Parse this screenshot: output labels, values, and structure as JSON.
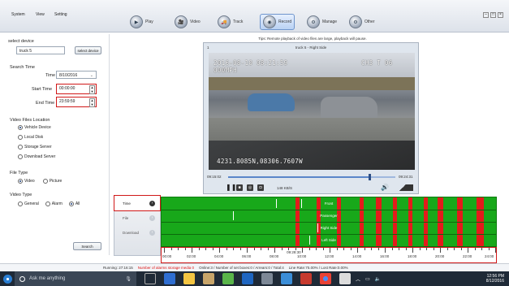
{
  "menu": [
    "System",
    "View",
    "Setting"
  ],
  "nav": [
    {
      "label": "Play",
      "icon": "play-icon",
      "glyph": "▶",
      "active": false
    },
    {
      "label": "Video",
      "icon": "video-icon",
      "glyph": "🎥",
      "active": false
    },
    {
      "label": "Track",
      "icon": "track-icon",
      "glyph": "🚚",
      "active": false
    },
    {
      "label": "Record",
      "icon": "record-icon",
      "glyph": "◉",
      "active": true
    },
    {
      "label": "Manage",
      "icon": "manage-icon",
      "glyph": "⚙",
      "active": false
    },
    {
      "label": "Other",
      "icon": "other-icon",
      "glyph": "⚙",
      "active": false
    }
  ],
  "left": {
    "select_device_heading": "select device",
    "device_value": "truck 5",
    "select_device_button": "select device",
    "search_time_heading": "Search Time",
    "time_label": "Time",
    "date_value": "8/10/2016",
    "start_label": "Start Time",
    "start_value": "00:00:00",
    "end_label": "End Time",
    "end_value": "23:59:59",
    "location_heading": "Video Files Location",
    "locations": [
      {
        "label": "Vehicle Device",
        "on": true
      },
      {
        "label": "Local Disk",
        "on": false
      },
      {
        "label": "Storage Server",
        "on": false
      },
      {
        "label": "Download Server",
        "on": false
      }
    ],
    "file_type_heading": "File Type",
    "file_types": [
      {
        "label": "Video",
        "on": true
      },
      {
        "label": "Picture",
        "on": false
      }
    ],
    "video_type_heading": "Video Type",
    "video_types": [
      {
        "label": "General",
        "on": false
      },
      {
        "label": "Alarm",
        "on": false
      },
      {
        "label": "All",
        "on": true
      }
    ],
    "search_button": "Search"
  },
  "player": {
    "tip": "Tips: Remote playback of video files are large, playback will pause.",
    "channel_number": "1",
    "title": "truck 5 - Right Side",
    "overlay_date": "2016-08-10 08:21:59",
    "overlay_speed": "000MPH",
    "overlay_right": "CH3 T 06",
    "overlay_coords": "4231.8085N,08306.7607W",
    "time_start": "09:15:02",
    "time_end": "09:24:31",
    "bitrate": "148 KB/S",
    "progress": 0.84
  },
  "timeline": {
    "tabs": [
      {
        "label": "Time",
        "active": true
      },
      {
        "label": "File",
        "active": false
      },
      {
        "label": "Download",
        "active": false
      }
    ],
    "rows": [
      "Front",
      "Passenger",
      "Right Side",
      "Left Side"
    ],
    "ticks": [
      "00:00",
      "02:00",
      "04:00",
      "06:00",
      "08:00",
      "10:00",
      "12:00",
      "14:00",
      "16:00",
      "18:00",
      "20:00",
      "22:00",
      "24:00"
    ],
    "cursor_label": "09:28:30",
    "alarm_segments_hours": [
      [
        9.6,
        9.9
      ],
      [
        11.1,
        11.4
      ],
      [
        12.6,
        12.9
      ],
      [
        14.2,
        14.5
      ],
      [
        15.4,
        15.8
      ],
      [
        16.6,
        16.9
      ],
      [
        17.7,
        18.0
      ],
      [
        18.8,
        19.1
      ],
      [
        19.8,
        20.2
      ],
      [
        21.2,
        21.6
      ],
      [
        22.6,
        23.1
      ]
    ],
    "event_marks_hours": [
      [
        5.1,
        1
      ],
      [
        8.2,
        0
      ],
      [
        10.0,
        0
      ],
      [
        11.2,
        2
      ],
      [
        10.6,
        3
      ]
    ]
  },
  "status": {
    "running": "Running: 27:16:15",
    "alarms": "Number of alarms storage media 0",
    "online": "Online:3 / Number of set boxes:0 / Arrears:0 / Total:4",
    "line_rate": "Line Rate:75.00% / Lost Rate:0.00%"
  },
  "taskbar": {
    "search_placeholder": "Ask me anything",
    "time": "12:56 PM",
    "date": "8/12/2016"
  }
}
